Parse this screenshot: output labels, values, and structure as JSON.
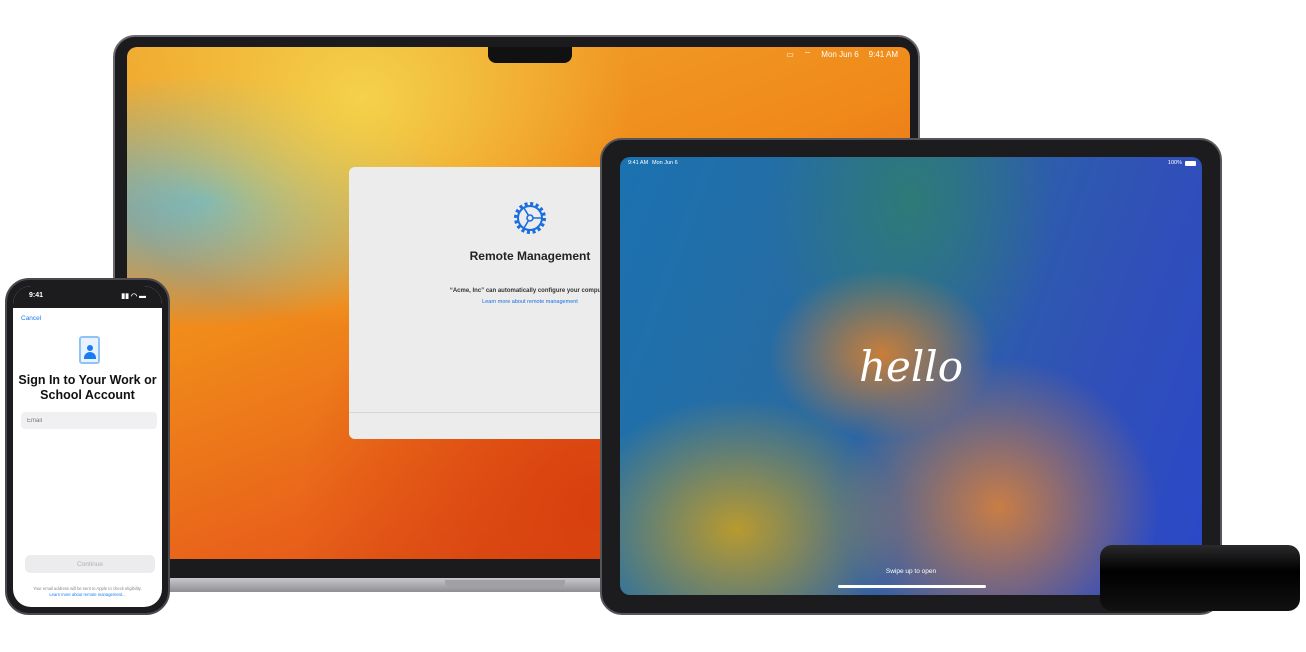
{
  "mac": {
    "menubar": {
      "date": "Mon Jun 6",
      "time": "9:41 AM"
    },
    "dialog": {
      "title": "Remote Management",
      "subtitle": "“Acme, Inc” can automatically configure your computer.",
      "link": "Learn more about remote management"
    }
  },
  "ipad": {
    "status": {
      "time": "9:41 AM",
      "date": "Mon Jun 6",
      "battery": "100%"
    },
    "greeting": "hello",
    "swipe_hint": "Swipe up to open"
  },
  "iphone": {
    "status_time": "9:41",
    "cancel": "Cancel",
    "title": "Sign In to Your Work or School Account",
    "email_placeholder": "Email",
    "continue": "Continue",
    "note": "Your email address will be sent to Apple to check eligibility.",
    "note_link": "Learn more about remote management..."
  },
  "colors": {
    "accent": "#1a7cf0"
  }
}
